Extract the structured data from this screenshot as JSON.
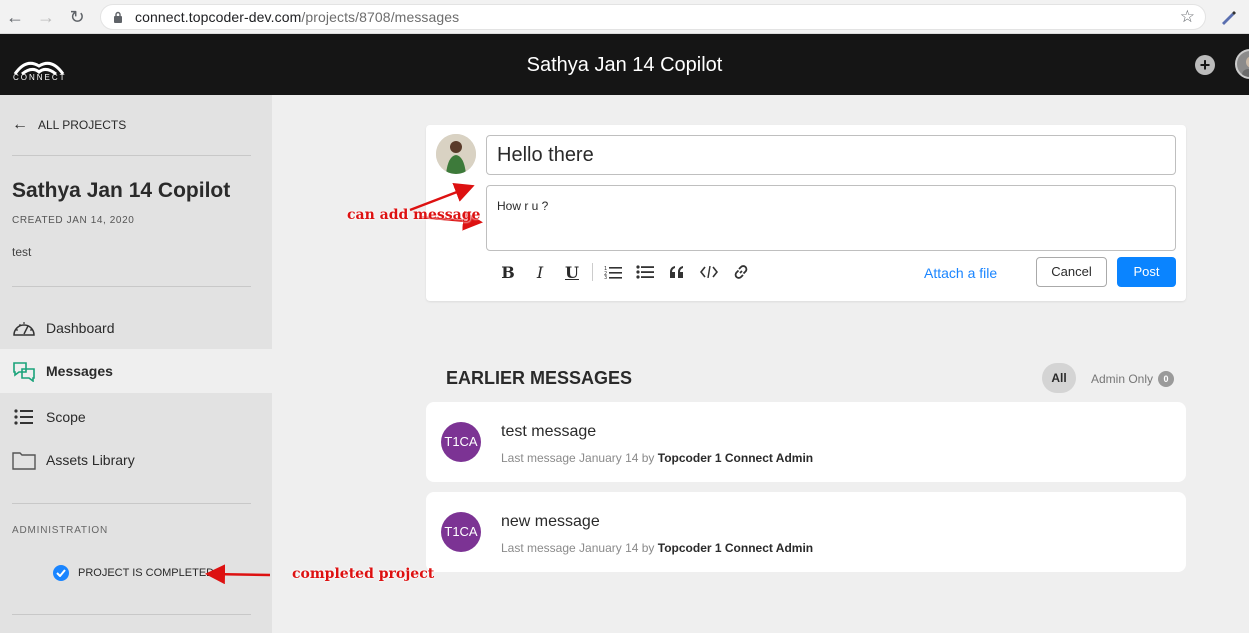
{
  "browser": {
    "url_host": "connect.topcoder-dev.com",
    "url_path": "/projects/8708/messages"
  },
  "header": {
    "logo_text": "CONNECT",
    "title": "Sathya Jan 14 Copilot"
  },
  "sidebar": {
    "back_label": "ALL PROJECTS",
    "project_name": "Sathya Jan 14 Copilot",
    "created": "CREATED JAN 14, 2020",
    "description": "test",
    "nav": [
      {
        "label": "Dashboard",
        "icon": "dashboard-icon"
      },
      {
        "label": "Messages",
        "icon": "messages-icon",
        "active": true
      },
      {
        "label": "Scope",
        "icon": "scope-list-icon"
      },
      {
        "label": "Assets Library",
        "icon": "folder-icon"
      }
    ],
    "admin_label": "ADMINISTRATION",
    "completed_label": "PROJECT IS COMPLETED"
  },
  "composer": {
    "title_value": "Hello there",
    "body_value": "How r u ?",
    "attach_label": "Attach a file",
    "cancel_label": "Cancel",
    "post_label": "Post"
  },
  "earlier": {
    "heading": "EARLIER MESSAGES",
    "filter_all": "All",
    "filter_admin": "Admin Only",
    "admin_count": "0",
    "messages": [
      {
        "avatar": "T1CA",
        "title": "test message",
        "meta_prefix": "Last message January 14 by",
        "author": "Topcoder 1 Connect Admin"
      },
      {
        "avatar": "T1CA",
        "title": "new message",
        "meta_prefix": "Last message January 14 by",
        "author": "Topcoder 1 Connect Admin"
      }
    ]
  },
  "annotations": {
    "add_message": "can add message",
    "completed": "completed project"
  },
  "colors": {
    "accent_blue": "#0a84ff",
    "annotation_red": "#dd1111",
    "avatar_purple": "#7c3394",
    "header_bg": "#151515"
  }
}
